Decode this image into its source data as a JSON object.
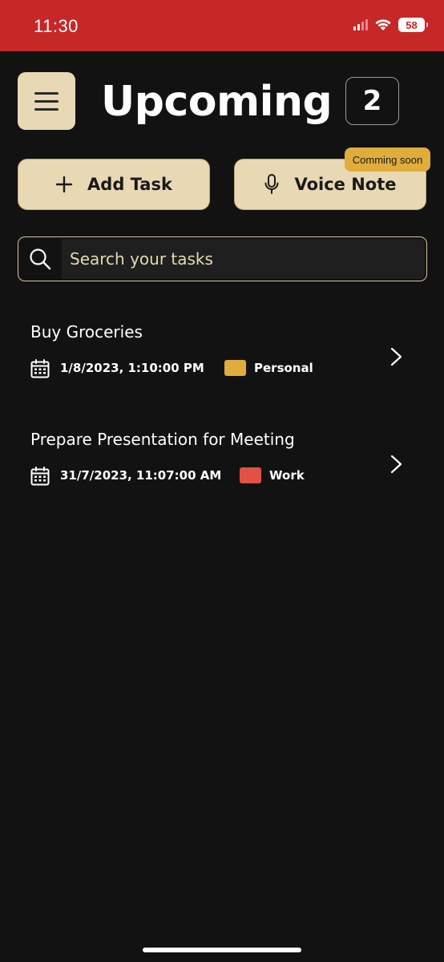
{
  "status_bar": {
    "time": "11:30",
    "battery": "58",
    "background": "#c62828"
  },
  "header": {
    "title": "Upcoming",
    "task_count": "2",
    "menu_icon": "hamburger-menu-icon"
  },
  "actions": {
    "add_task_label": "Add Task",
    "add_task_icon": "plus-icon",
    "voice_note_label": "Voice Note",
    "voice_note_icon": "microphone-icon",
    "voice_note_badge": "Comming soon"
  },
  "search": {
    "placeholder": "Search your tasks",
    "value": ""
  },
  "tasks": [
    {
      "title": "Buy Groceries",
      "datetime": "1/8/2023, 1:10:00 PM",
      "category": "Personal",
      "category_color": "#e0ac3c"
    },
    {
      "title": "Prepare Presentation for Meeting",
      "datetime": "31/7/2023, 11:07:00 AM",
      "category": "Work",
      "category_color": "#e05246"
    }
  ],
  "colors": {
    "background": "#121212",
    "accent": "#e8d9b4",
    "status_bar": "#c62828"
  }
}
